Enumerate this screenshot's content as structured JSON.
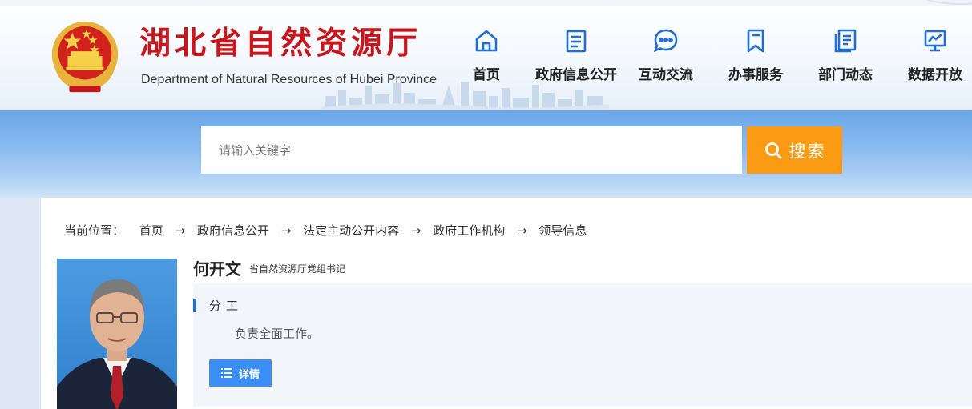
{
  "header": {
    "site_title": "湖北省自然资源厅",
    "site_subtitle": "Department of Natural Resources of Hubei Province",
    "emblem_icon": "national-emblem-icon"
  },
  "nav": {
    "items": [
      {
        "label": "首页",
        "icon": "home-icon"
      },
      {
        "label": "政府信息公开",
        "icon": "document-icon"
      },
      {
        "label": "互动交流",
        "icon": "chat-bubble-icon"
      },
      {
        "label": "办事服务",
        "icon": "bookmark-icon"
      },
      {
        "label": "部门动态",
        "icon": "news-icon"
      },
      {
        "label": "数据开放",
        "icon": "data-chart-icon"
      }
    ]
  },
  "search": {
    "placeholder": "请输入关键字",
    "button_label": "搜索"
  },
  "breadcrumb": {
    "label": "当前位置：",
    "items": [
      "首页",
      "政府信息公开",
      "法定主动公开内容",
      "政府工作机构",
      "领导信息"
    ],
    "separator": "→"
  },
  "leader": {
    "name": "何开文",
    "title": "省自然资源厅党组书记",
    "section_title": "分工",
    "duty": "负责全面工作。",
    "detail_label": "详情"
  },
  "colors": {
    "brand_red": "#c8161d",
    "search_orange": "#fb9b13",
    "accent_blue": "#3a8ef6",
    "nav_icon_blue": "#1d6fd5"
  }
}
